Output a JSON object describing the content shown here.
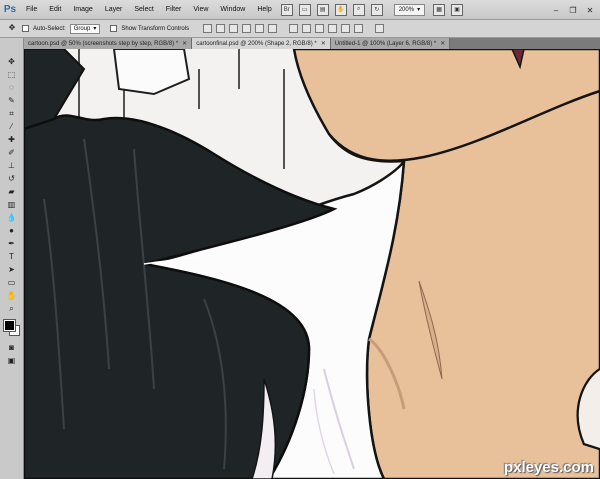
{
  "app": {
    "logo": "Ps"
  },
  "menu": [
    "File",
    "Edit",
    "Image",
    "Layer",
    "Select",
    "Filter",
    "View",
    "Window",
    "Help"
  ],
  "menubar_icons": [
    "bridge-icon",
    "minibridge-icon",
    "ruler-icon",
    "hand-icon",
    "zoom-icon",
    "rotate-icon"
  ],
  "zoom": {
    "value": "200%"
  },
  "options": {
    "auto_select_label": "Auto-Select:",
    "auto_select_value": "Group",
    "show_transform_label": "Show Transform Controls"
  },
  "tabs": [
    {
      "label": "cartoon.psd @ 50% (screenshots step by step, RGB/8) *",
      "active": false
    },
    {
      "label": "cartoonfinal.psd @ 200% (Shape 2, RGB/8) *",
      "active": true
    },
    {
      "label": "Untitled-1 @ 100% (Layer 6, RGB/8) *",
      "active": false
    }
  ],
  "tools": [
    "move-icon",
    "marquee-icon",
    "lasso-icon",
    "quick-select-icon",
    "crop-icon",
    "eyedropper-icon",
    "healing-icon",
    "brush-icon",
    "stamp-icon",
    "history-brush-icon",
    "eraser-icon",
    "gradient-icon",
    "blur-icon",
    "dodge-icon",
    "pen-icon",
    "type-icon",
    "path-select-icon",
    "shape-icon",
    "hand-tool-icon",
    "zoom-tool-icon"
  ],
  "colors": {
    "foreground": "#000000",
    "background": "#ffffff",
    "skin": "#e8c09a",
    "suit": "#1f2426",
    "shirt": "#ffffff"
  },
  "watermark": "pxleyes.com"
}
